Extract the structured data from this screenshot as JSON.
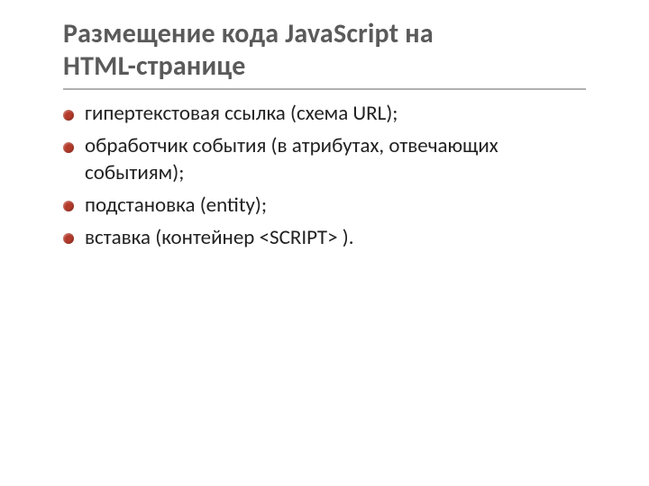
{
  "title": {
    "line1": "Размещение кода JavaScript на",
    "line2": "HTML-странице"
  },
  "bullets": [
    "гипертекстовая ссылка (схема URL);",
    "обработчик события (в атрибутах, отвечающих событиям);",
    "подстановка (entity);",
    "вставка (контейнер <SCRIPT> )."
  ]
}
